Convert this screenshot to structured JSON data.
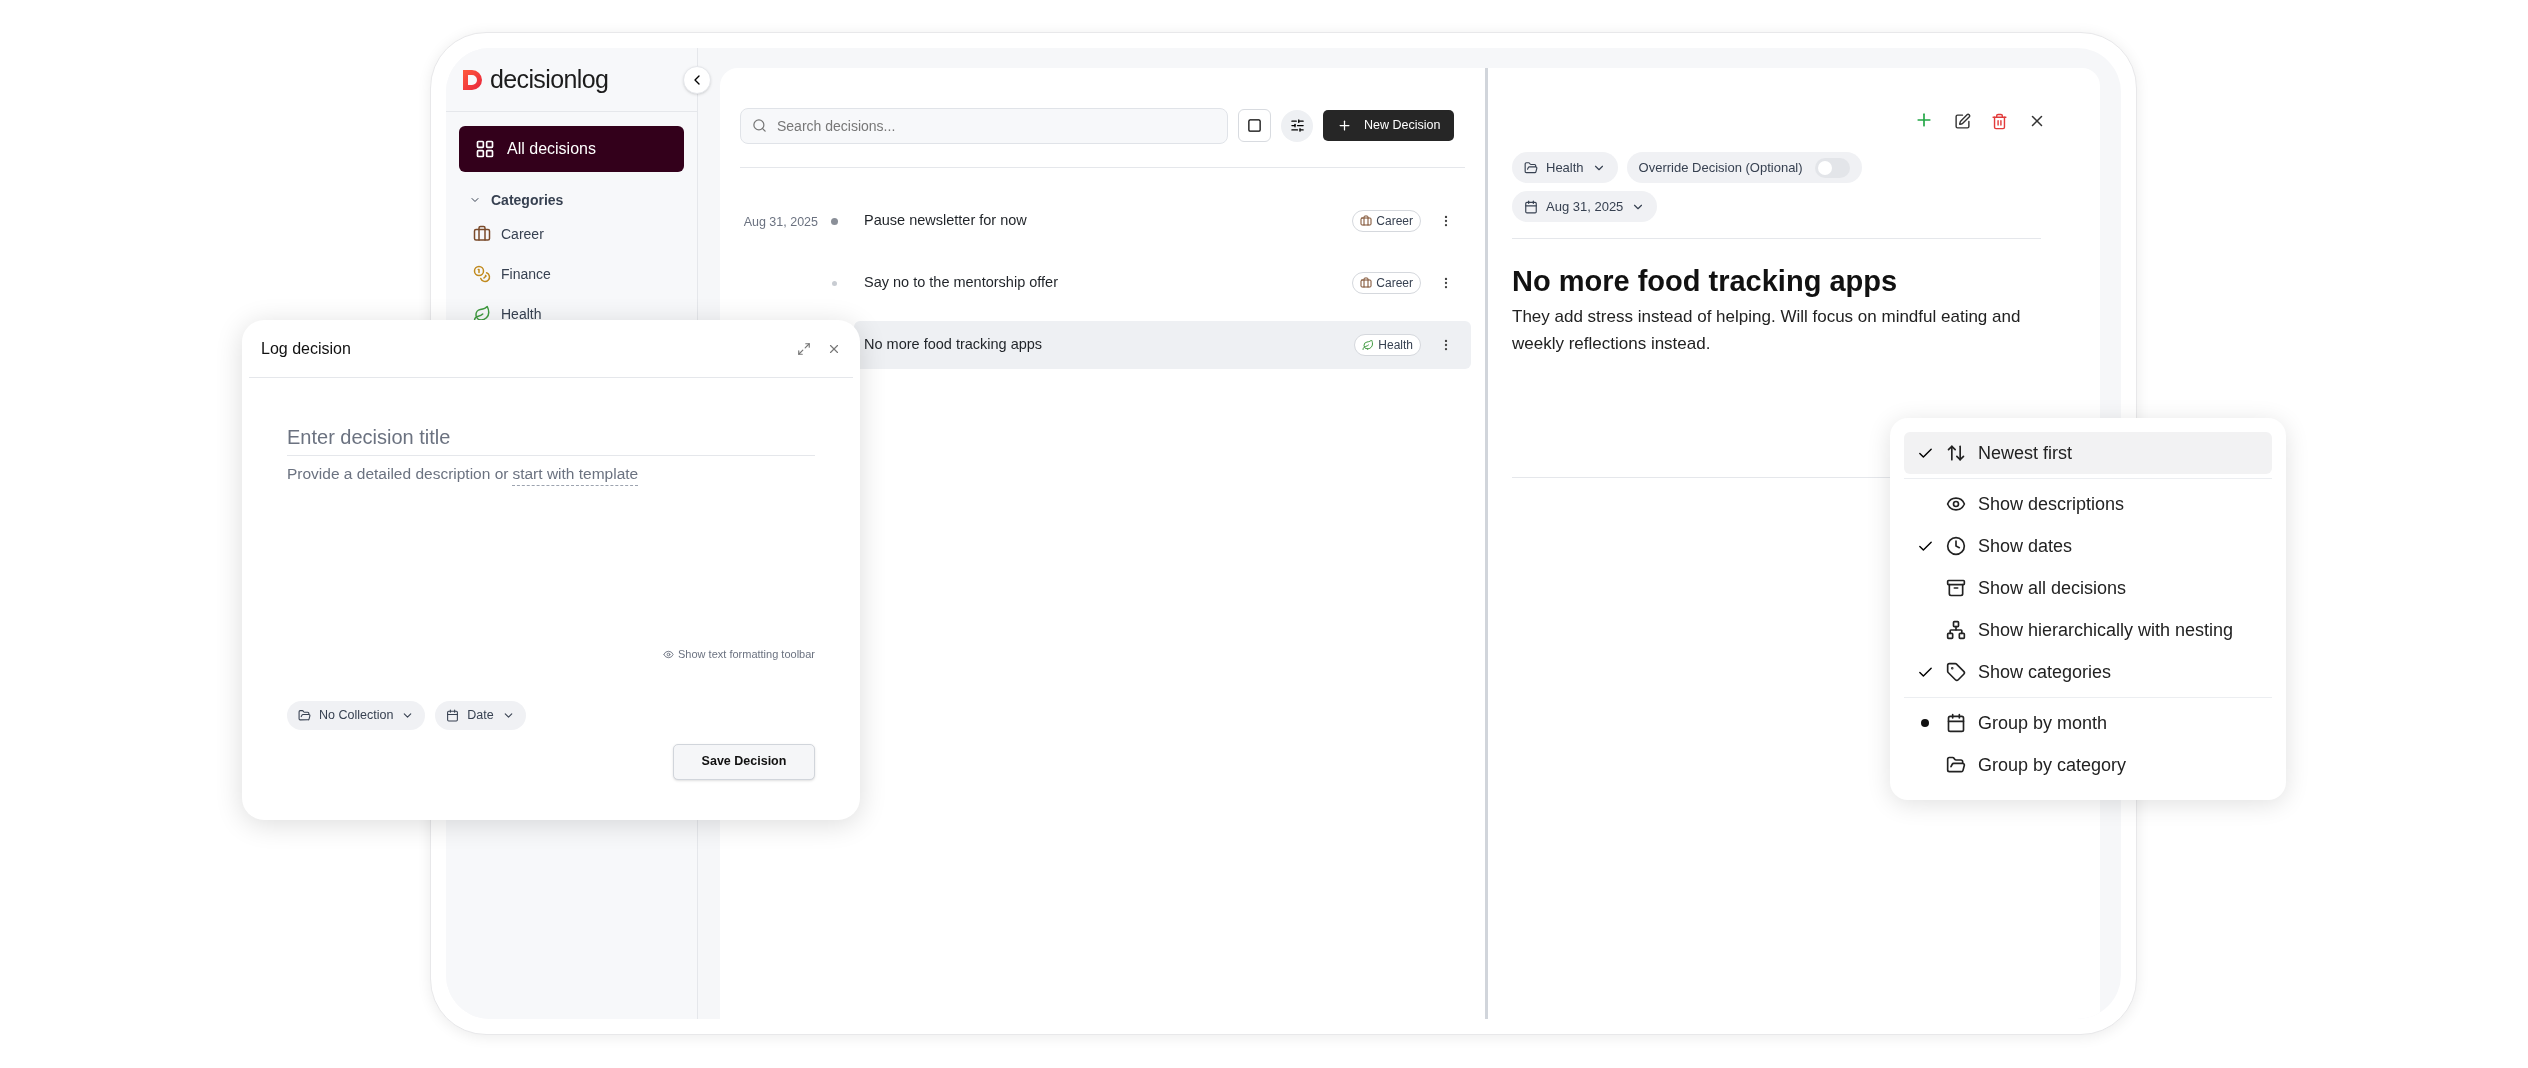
{
  "brand": {
    "name": "decisionlog"
  },
  "sidebar": {
    "items": [
      {
        "label": "All decisions",
        "selected": true
      }
    ],
    "categories_header": {
      "label": "Categories",
      "expanded": true
    },
    "categories": [
      {
        "label": "Career",
        "kind": "briefcase"
      },
      {
        "label": "Finance",
        "kind": "money"
      },
      {
        "label": "Health",
        "kind": "leaf"
      }
    ]
  },
  "toolbar": {
    "search": {
      "placeholder": "Search decisions..."
    },
    "new_button": "New Decision"
  },
  "decisions": [
    {
      "date": "Aug 31, 2025",
      "title": "Pause newsletter for now",
      "category": {
        "label": "Career",
        "kind": "briefcase"
      },
      "selected": false
    },
    {
      "title": "Say no to the mentorship offer",
      "category": {
        "label": "Career",
        "kind": "briefcase"
      },
      "selected": false
    },
    {
      "title": "No more food tracking apps",
      "category": {
        "label": "Health",
        "kind": "leaf"
      },
      "selected": true
    }
  ],
  "detail": {
    "category": "Health",
    "override": {
      "label": "Override Decision (Optional)",
      "on": false
    },
    "date": "Aug 31, 2025",
    "title": "No more food tracking apps",
    "description": "They add stress instead of helping. Will focus on mindful eating and weekly reflections instead."
  },
  "view_menu": {
    "sections": [
      {
        "items": [
          {
            "label": "Newest first",
            "kind": "sort",
            "checked": true,
            "highlighted": true
          }
        ]
      },
      {
        "items": [
          {
            "label": "Show descriptions",
            "kind": "eye",
            "checked": false,
            "highlighted": false
          },
          {
            "label": "Show dates",
            "kind": "clock",
            "checked": true,
            "highlighted": false
          },
          {
            "label": "Show all decisions",
            "kind": "archive",
            "checked": false,
            "highlighted": false
          },
          {
            "label": "Show hierarchically with nesting",
            "kind": "hierarchy",
            "checked": false,
            "highlighted": false
          },
          {
            "label": "Show categories",
            "kind": "tag",
            "checked": true,
            "highlighted": false
          }
        ]
      },
      {
        "items": [
          {
            "label": "Group by month",
            "kind": "calendar",
            "selected": true,
            "highlighted": false
          },
          {
            "label": "Group by category",
            "kind": "folder",
            "selected": false,
            "highlighted": false
          }
        ]
      }
    ]
  },
  "log_dialog": {
    "title": "Log decision",
    "title_field": {
      "placeholder": "Enter decision title"
    },
    "description_prompt": "Provide a detailed description or",
    "template_link": "start with template",
    "formatting_toggle": "Show text formatting toolbar",
    "collection": "No Collection",
    "date": "Date",
    "save_button": "Save Decision"
  }
}
